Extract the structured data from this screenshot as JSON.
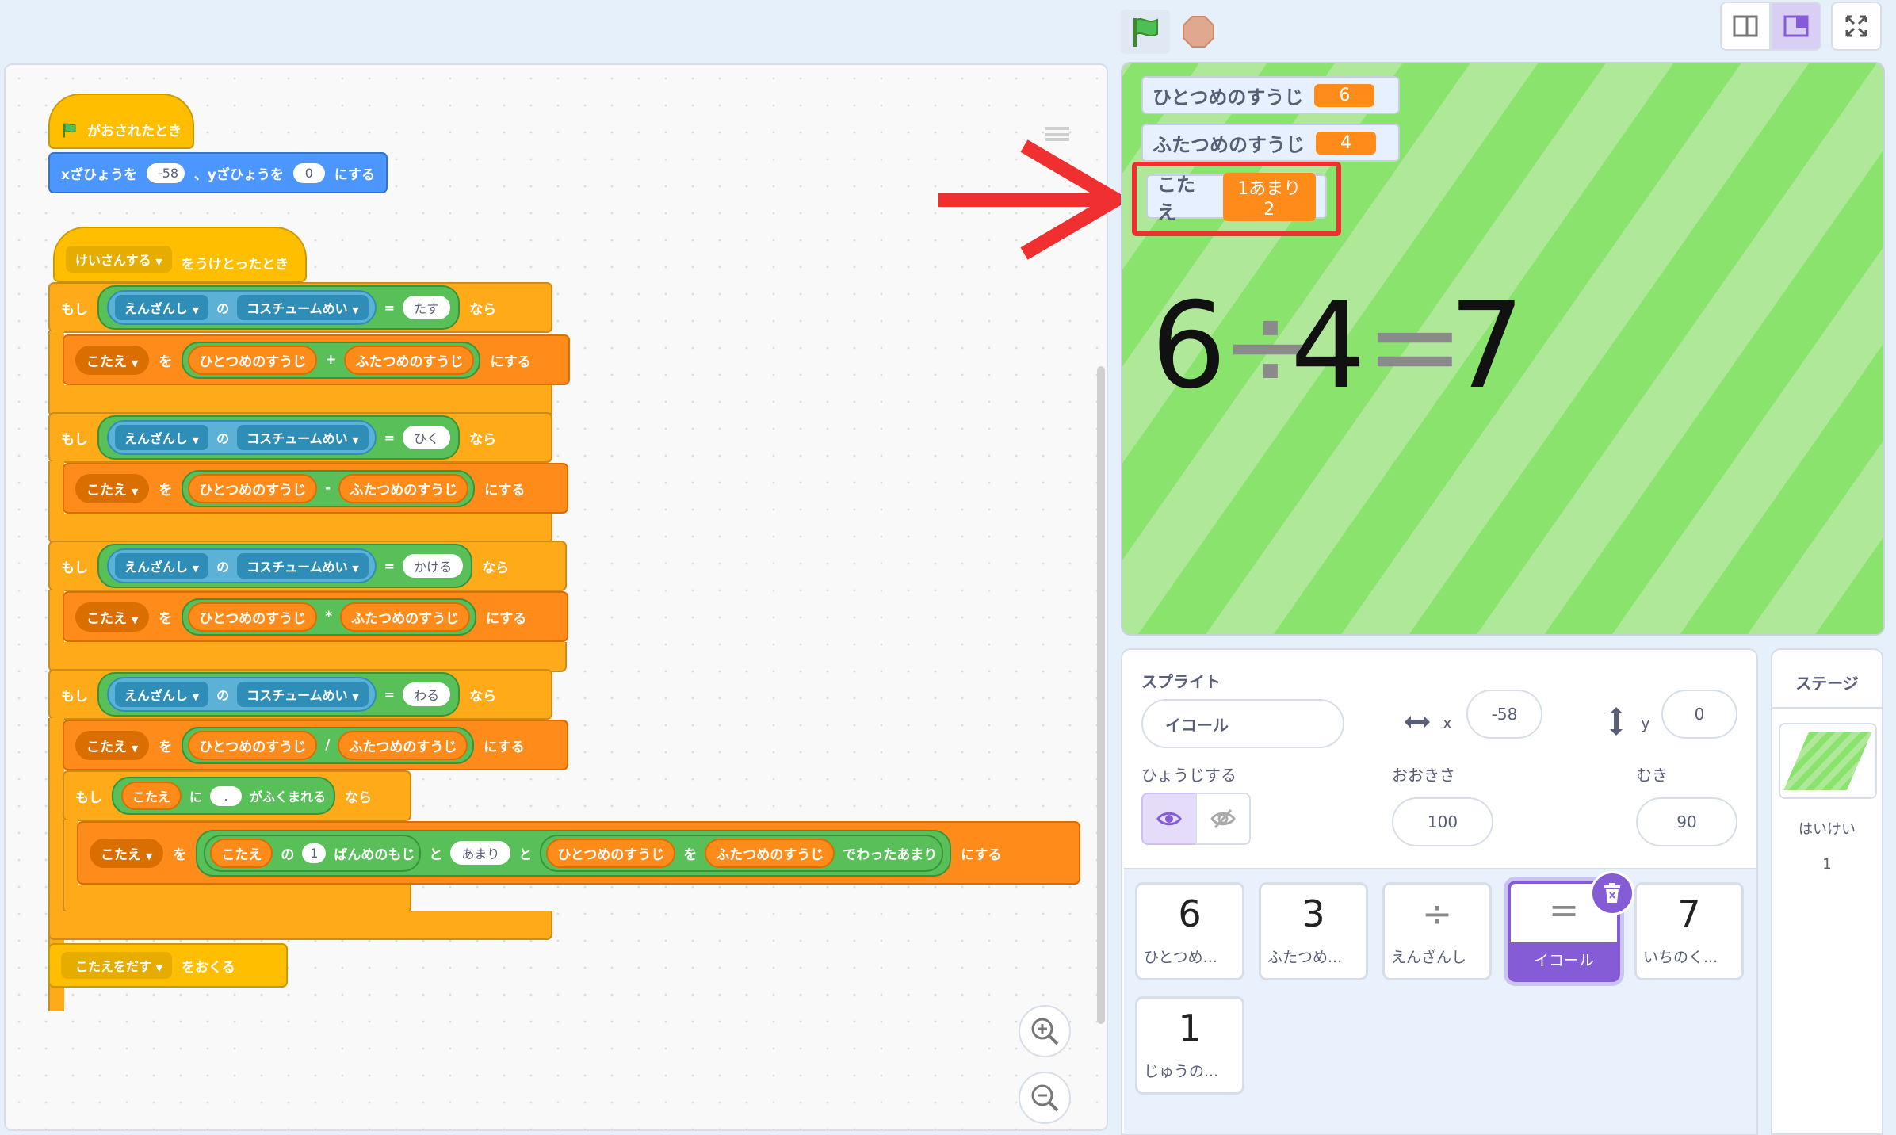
{
  "header": {
    "green_flag": "green-flag-icon",
    "stop": "stop-icon",
    "layout_small": "small-stage-icon",
    "layout_normal": "normal-stage-icon",
    "fullscreen": "fullscreen-icon"
  },
  "script1": {
    "hat": "がおされたとき",
    "goto_x_label": "xざひょうを",
    "goto_x_val": "-58",
    "goto_y_label": "、yざひょうを",
    "goto_y_val": "0",
    "goto_end": "にする"
  },
  "script2": {
    "hat_msg": "けいさんする",
    "hat_text": "をうけとったとき",
    "if_label": "もし",
    "then_label": "なら",
    "sprite_dd": "えんざんし",
    "of_label": "の",
    "costume_dd": "コスチュームめい",
    "eq": "=",
    "answer_var": "こたえ",
    "wo": "を",
    "first": "ひとつめのすうじ",
    "second": "ふたつめのすうじ",
    "set_end": "にする",
    "ops": [
      {
        "word": "たす",
        "sym": "+"
      },
      {
        "word": "ひく",
        "sym": "-"
      },
      {
        "word": "かける",
        "sym": "*"
      },
      {
        "word": "わる",
        "sym": "/"
      }
    ],
    "ni": "に",
    "contains_val": ".",
    "contains_text": "がふくまれる",
    "letter_num": "1",
    "letter_text": "ばんめのもじ",
    "join_to": "と",
    "amari": "あまり",
    "remainder_text": "でわったあまり",
    "broadcast_msg": "こたえをだす",
    "broadcast_text": "をおくる"
  },
  "stage": {
    "monitors": [
      {
        "label": "ひとつめのすうじ",
        "value": "6"
      },
      {
        "label": "ふたつめのすうじ",
        "value": "4"
      },
      {
        "label": "こたえ",
        "value": "1あまり2"
      }
    ],
    "equation": [
      "6",
      "÷",
      "4",
      "=",
      "7"
    ]
  },
  "sprite_panel": {
    "title": "スプライト",
    "sprite_name": "イコール",
    "x_label": "x",
    "x_val": "-58",
    "y_label": "y",
    "y_val": "0",
    "show_label": "ひょうじする",
    "size_label": "おおきさ",
    "size_val": "100",
    "dir_label": "むき",
    "dir_val": "90"
  },
  "sprites": [
    {
      "glyph": "6",
      "name": "ひとつめ..."
    },
    {
      "glyph": "3",
      "name": "ふたつめ..."
    },
    {
      "glyph": "÷",
      "name": "えんざんし"
    },
    {
      "glyph": "=",
      "name": "イコール"
    },
    {
      "glyph": "7",
      "name": "いちのく..."
    },
    {
      "glyph": "1",
      "name": "じゅうの..."
    }
  ],
  "stage_panel": {
    "title": "ステージ",
    "backdrop_label": "はいけい",
    "backdrop_count": "1"
  },
  "colors": {
    "annotation_red": "#f03030",
    "selected_purple": "#855cd6"
  }
}
